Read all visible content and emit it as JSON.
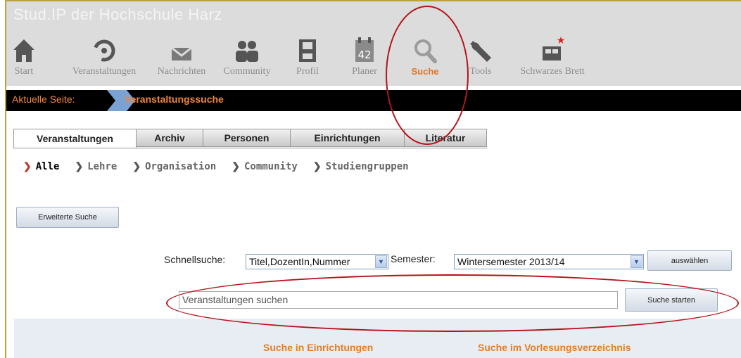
{
  "header": {
    "brand": "Stud.IP der Hochschule Harz",
    "nav": [
      {
        "label": "Start",
        "icon": "home-icon"
      },
      {
        "label": "Veranstaltungen",
        "icon": "courses-icon"
      },
      {
        "label": "Nachrichten",
        "icon": "envelope-icon"
      },
      {
        "label": "Community",
        "icon": "people-icon"
      },
      {
        "label": "Profil",
        "icon": "profile-icon"
      },
      {
        "label": "Planer",
        "icon": "calendar-icon",
        "icon_text": "42"
      },
      {
        "label": "Suche",
        "icon": "search-icon",
        "active": true
      },
      {
        "label": "Tools",
        "icon": "wrench-icon"
      },
      {
        "label": "Schwarzes Brett",
        "icon": "bulletin-board-icon"
      }
    ]
  },
  "breadcrumb": {
    "label": "Aktuelle Seite:",
    "current": "Veranstaltungssuche"
  },
  "tabs": [
    {
      "label": "Veranstaltungen",
      "active": true
    },
    {
      "label": "Archiv"
    },
    {
      "label": "Personen"
    },
    {
      "label": "Einrichtungen"
    },
    {
      "label": "Literatur"
    }
  ],
  "subnav": [
    {
      "label": "Alle",
      "active": true
    },
    {
      "label": "Lehre"
    },
    {
      "label": "Organisation"
    },
    {
      "label": "Community"
    },
    {
      "label": "Studiengruppen"
    }
  ],
  "search": {
    "extended_button": "Erweiterte Suche",
    "quick_label": "Schnellsuche:",
    "quick_value": "Titel,DozentIn,Nummer",
    "semester_label": "Semester:",
    "semester_value": "Wintersemester 2013/14",
    "select_button": "auswählen",
    "placeholder": "Veranstaltungen suchen",
    "start_button": "Suche starten"
  },
  "panel": {
    "link_institutes": "Suche in Einrichtungen",
    "link_catalog": "Suche im Vorlesungsverzeichnis"
  },
  "colors": {
    "accent": "#e67e22",
    "annotation": "#b3141a",
    "breadcrumb_bg": "#000000"
  }
}
